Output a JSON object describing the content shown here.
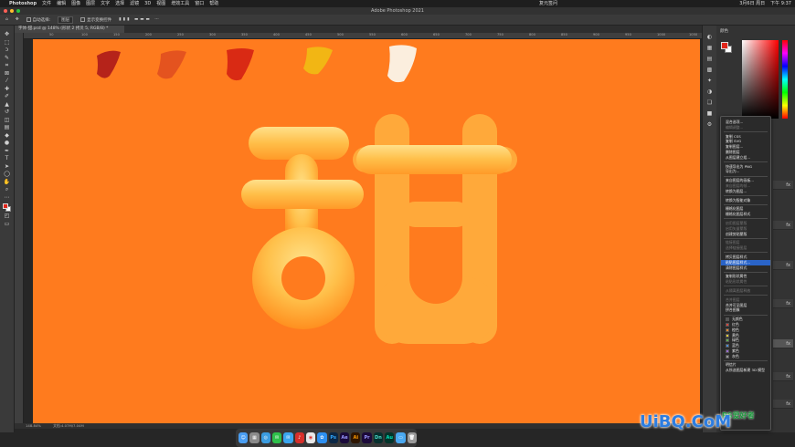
{
  "menubar": {
    "app": "Photoshop",
    "items": [
      "文件",
      "编辑",
      "图像",
      "图层",
      "文字",
      "选择",
      "滤镜",
      "3D",
      "视图",
      "增效工具",
      "窗口",
      "帮助"
    ],
    "center": "复元签问",
    "date": "3月6日 周日",
    "clock": "下午 9:37"
  },
  "titlebar": {
    "title": "Adobe Photoshop 2021"
  },
  "options": {
    "auto_select": "自动选择:",
    "layer_select": "图层",
    "show_transform": "显示变换控件"
  },
  "doc_tab": {
    "label": "字体-甜.psd @ 148% (形状 2 拷贝 5, RGB/8) *"
  },
  "ruler": {
    "ticks": [
      "50",
      "100",
      "150",
      "200",
      "250",
      "300",
      "350",
      "400",
      "450",
      "500",
      "550",
      "600",
      "650",
      "700",
      "750",
      "800",
      "850",
      "900",
      "950",
      "1000",
      "1050"
    ]
  },
  "status": {
    "zoom": "148.84%",
    "doc": "文档:4.07M/7.04M"
  },
  "panel": {
    "color_title": "颜色"
  },
  "context_menu": {
    "items": [
      {
        "label": "混合选项...",
        "state": "normal"
      },
      {
        "label": "编辑调整...",
        "state": "disabled"
      },
      {
        "sep": true
      },
      {
        "label": "复制 CSS",
        "state": "normal"
      },
      {
        "label": "复制 SVG",
        "state": "normal"
      },
      {
        "label": "复制图层...",
        "state": "normal"
      },
      {
        "label": "删除图层",
        "state": "normal"
      },
      {
        "label": "从图层建立组...",
        "state": "normal"
      },
      {
        "sep": true
      },
      {
        "label": "快速导出为 PNG",
        "state": "normal"
      },
      {
        "label": "导出为...",
        "state": "normal"
      },
      {
        "sep": true
      },
      {
        "label": "来自图层的画板...",
        "state": "normal"
      },
      {
        "label": "来自图层的帧...",
        "state": "disabled"
      },
      {
        "label": "转换为图层...",
        "state": "normal"
      },
      {
        "sep": true
      },
      {
        "label": "转换为智能对象",
        "state": "normal"
      },
      {
        "sep": true
      },
      {
        "label": "栅格化图层",
        "state": "normal"
      },
      {
        "label": "栅格化图层样式",
        "state": "normal"
      },
      {
        "sep": true
      },
      {
        "label": "启用图层蒙版",
        "state": "disabled"
      },
      {
        "label": "启用矢量蒙版",
        "state": "disabled"
      },
      {
        "label": "创建剪贴蒙版",
        "state": "normal"
      },
      {
        "sep": true
      },
      {
        "label": "链接图层",
        "state": "disabled"
      },
      {
        "label": "选择链接图层",
        "state": "disabled"
      },
      {
        "sep": true
      },
      {
        "label": "拷贝图层样式",
        "state": "normal"
      },
      {
        "label": "粘贴图层样式...",
        "state": "highlighted"
      },
      {
        "label": "清除图层样式",
        "state": "normal"
      },
      {
        "sep": true
      },
      {
        "label": "复制形状属性",
        "state": "normal"
      },
      {
        "label": "粘贴形状属性",
        "state": "disabled"
      },
      {
        "sep": true
      },
      {
        "label": "从隔离图层释放",
        "state": "disabled"
      },
      {
        "sep": true
      },
      {
        "label": "合并图层",
        "state": "disabled"
      },
      {
        "label": "合并可见图层",
        "state": "normal"
      },
      {
        "label": "拼合图像",
        "state": "normal"
      },
      {
        "sep": true
      },
      {
        "label": "无颜色",
        "state": "normal",
        "color": "#555555"
      },
      {
        "label": "红色",
        "state": "normal",
        "color": "#d9453e"
      },
      {
        "label": "橙色",
        "state": "normal",
        "color": "#e98a2e"
      },
      {
        "label": "黄色",
        "state": "normal",
        "color": "#e7cd3a"
      },
      {
        "label": "绿色",
        "state": "normal",
        "color": "#5fb04f"
      },
      {
        "label": "蓝色",
        "state": "normal",
        "color": "#4d8fd9"
      },
      {
        "label": "紫色",
        "state": "normal",
        "color": "#9a6bd1"
      },
      {
        "label": "灰色",
        "state": "normal",
        "color": "#9a9a9a"
      },
      {
        "sep": true
      },
      {
        "label": "明信片",
        "state": "normal"
      },
      {
        "label": "从所选图层新建 3D 模型",
        "state": "normal"
      }
    ]
  },
  "layers_visible_labels": [
    "fx",
    "fx",
    "fx",
    "fx",
    "fx",
    "fx",
    "fx"
  ],
  "dock": {
    "apps": [
      "Ps",
      "Ae",
      "Ai",
      "Pr",
      "Dn",
      "Au"
    ]
  },
  "watermark": {
    "text": "UiBQ.CoM",
    "sub": "PS爱好者"
  },
  "colors": {
    "canvas": "#ff7b1e",
    "accent": "#2a64c8"
  }
}
